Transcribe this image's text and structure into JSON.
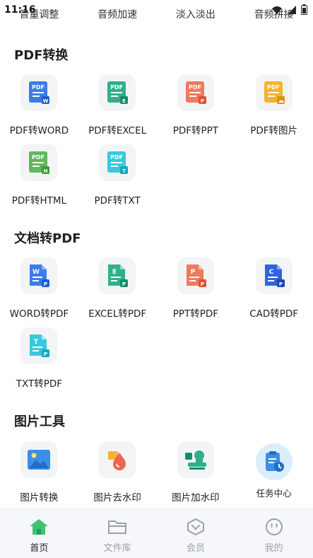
{
  "status": {
    "time": "11:16"
  },
  "top_row": [
    "音量调整",
    "音频加速",
    "淡入淡出",
    "音频拼接"
  ],
  "sections": {
    "pdf_convert": {
      "title": "PDF转换",
      "items": [
        "PDF转WORD",
        "PDF转EXCEL",
        "PDF转PPT",
        "PDF转图片",
        "PDF转HTML",
        "PDF转TXT"
      ]
    },
    "doc_to_pdf": {
      "title": "文档转PDF",
      "items": [
        "WORD转PDF",
        "EXCEL转PDF",
        "PPT转PDF",
        "CAD转PDF",
        "TXT转PDF"
      ]
    },
    "image_tools": {
      "title": "图片工具",
      "items": [
        "图片转换",
        "图片去水印",
        "图片加水印"
      ],
      "task_center": "任务中心"
    }
  },
  "bottom_nav": [
    "首页",
    "文件库",
    "会员",
    "我的"
  ],
  "colors": {
    "word_blue": "#3b7de8",
    "excel_green": "#2fb08a",
    "ppt_red": "#f07a5c",
    "image_orange": "#f5b32e",
    "html_green": "#5fb85a",
    "txt_cyan": "#38c9de",
    "cad_blue": "#2f64e0",
    "nav_active": "#3fc275"
  }
}
